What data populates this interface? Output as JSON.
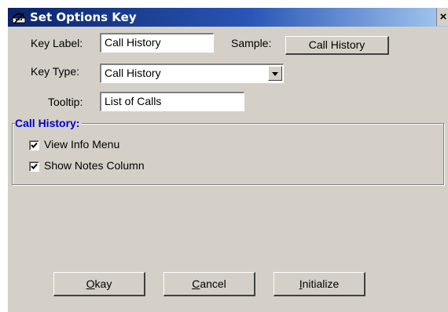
{
  "window": {
    "title": "Set Options Key",
    "close_symbol": "×"
  },
  "fields": {
    "key_label": {
      "label": "Key Label:",
      "value": "Call History"
    },
    "sample": {
      "label": "Sample:",
      "button_text": "Call History"
    },
    "key_type": {
      "label": "Key Type:",
      "selected": "Call History"
    },
    "tooltip": {
      "label": "Tooltip:",
      "value": "List of Calls"
    }
  },
  "group": {
    "title": "Call History:",
    "options": [
      {
        "label": "View Info Menu",
        "checked": true
      },
      {
        "label": "Show Notes Column",
        "checked": true
      }
    ]
  },
  "buttons": {
    "okay": {
      "mnemonic": "O",
      "rest": "kay"
    },
    "cancel": {
      "mnemonic": "C",
      "rest": "ancel"
    },
    "initialize": {
      "mnemonic": "I",
      "rest": "nitialize"
    }
  },
  "colors": {
    "group_title": "#0000cc",
    "titlebar_start": "#0a246a",
    "titlebar_end": "#a6caf0",
    "face": "#d4d0c8"
  }
}
